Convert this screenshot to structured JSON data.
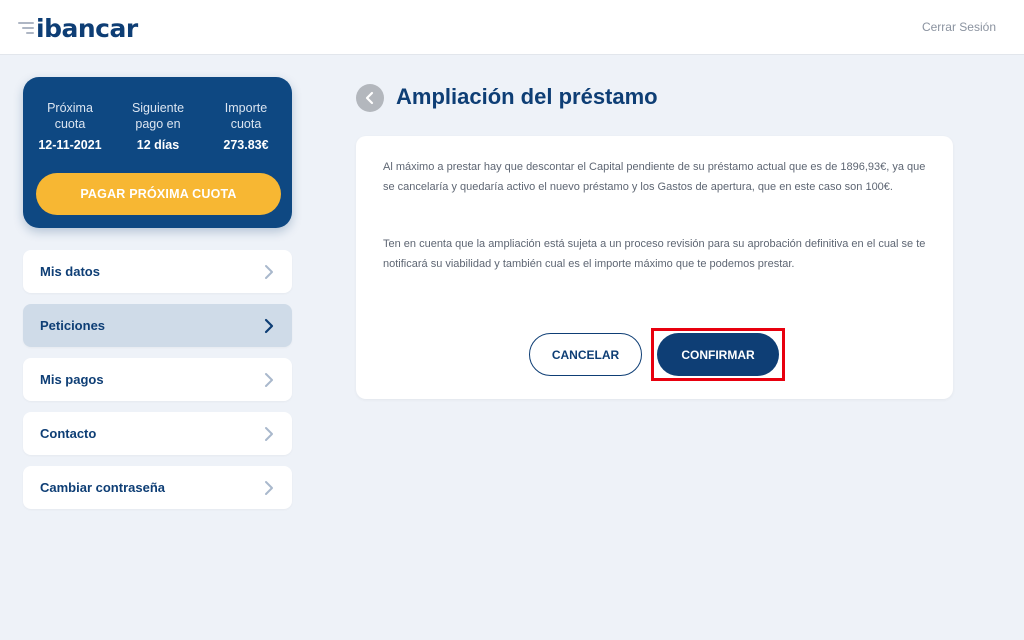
{
  "header": {
    "logo_text": "ibancar",
    "logout_label": "Cerrar Sesión"
  },
  "summary": {
    "next_installment": {
      "label": "Próxima cuota",
      "value": "12-11-2021"
    },
    "next_payment": {
      "label": "Siguiente pago en",
      "value": "12 días"
    },
    "amount": {
      "label": "Importe cuota",
      "value": "273.83€"
    },
    "pay_button_label": "PAGAR PRÓXIMA CUOTA"
  },
  "menu": {
    "items": [
      {
        "label": "Mis datos",
        "active": false
      },
      {
        "label": "Peticiones",
        "active": true
      },
      {
        "label": "Mis pagos",
        "active": false
      },
      {
        "label": "Contacto",
        "active": false
      },
      {
        "label": "Cambiar contraseña",
        "active": false
      }
    ]
  },
  "main": {
    "title": "Ampliación del préstamo",
    "paragraph_1": "Al máximo a prestar hay que descontar el Capital pendiente de su préstamo actual que es de 1896,93€, ya que se cancelaría y quedaría activo el nuevo préstamo y los Gastos de apertura, que en este caso son 100€.",
    "paragraph_2": "Ten en cuenta que la ampliación está sujeta a un proceso revisión para su aprobación definitiva en el cual se te notificará su viabilidad y también cual es el importe máximo que te podemos prestar.",
    "cancel_label": "CANCELAR",
    "confirm_label": "CONFIRMAR"
  },
  "icons": {
    "back": "chevron-left-icon",
    "menu_arrow": "chevron-right-icon"
  },
  "colors": {
    "brand_navy": "#0e3e75",
    "summary_card": "#0e4882",
    "accent_yellow": "#f7b733",
    "active_menu": "#cfdbe8",
    "background": "#eef2f8",
    "highlight_red": "#e8000e"
  }
}
